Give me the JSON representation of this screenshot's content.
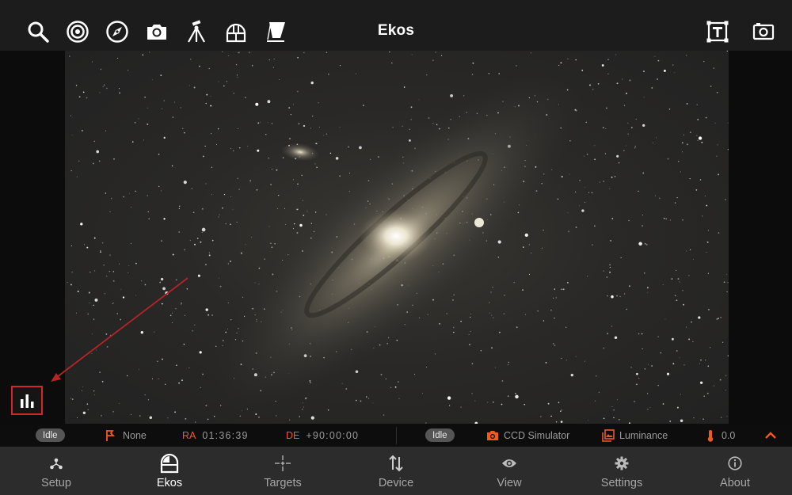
{
  "app": {
    "title": "Ekos"
  },
  "toolbar": {
    "left_tools": [
      {
        "icon": "search-icon"
      },
      {
        "icon": "target-icon"
      },
      {
        "icon": "compass-icon"
      },
      {
        "icon": "camera-icon"
      },
      {
        "icon": "tripod-mount-icon"
      },
      {
        "icon": "dome-icon"
      },
      {
        "icon": "flat-panel-icon"
      }
    ],
    "right_tools": [
      {
        "icon": "text-frame-icon"
      },
      {
        "icon": "capture-frame-icon"
      }
    ]
  },
  "viewer": {
    "object": "andromeda-galaxy-image"
  },
  "status": {
    "mount_state": "Idle",
    "park_status": "None",
    "ra_label": "RA",
    "ra_value": "01:36:39",
    "de_label": "DE",
    "de_value": "+90:00:00",
    "camera_state": "Idle",
    "camera_name": "CCD Simulator",
    "filter_name": "Luminance",
    "temperature": "0.0",
    "accent_color": "#f05a1e"
  },
  "nav": {
    "items": [
      {
        "label": "Setup",
        "icon": "setup-nodes-icon"
      },
      {
        "label": "Ekos",
        "icon": "observatory-icon"
      },
      {
        "label": "Targets",
        "icon": "crosshair-star-icon"
      },
      {
        "label": "Device",
        "icon": "updown-arrows-icon"
      },
      {
        "label": "View",
        "icon": "eye-icon"
      },
      {
        "label": "Settings",
        "icon": "gear-icon"
      },
      {
        "label": "About",
        "icon": "info-icon"
      }
    ],
    "active": "Ekos"
  }
}
